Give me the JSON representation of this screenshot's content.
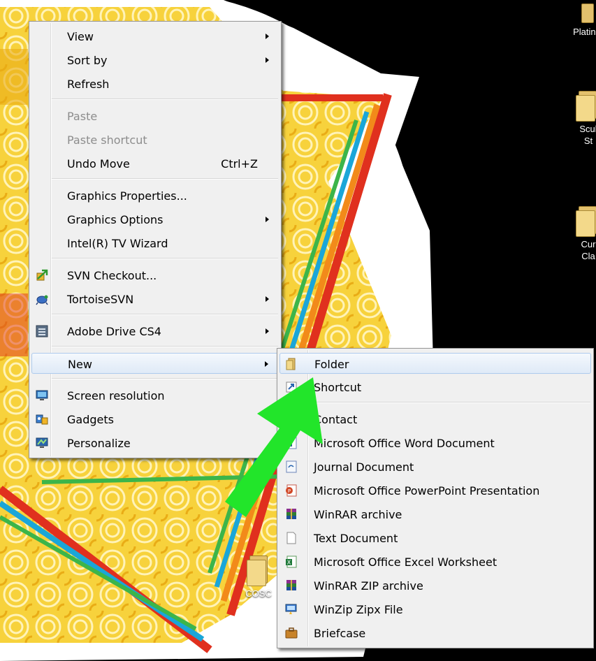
{
  "desktop": {
    "icons": [
      {
        "label": "Platinu"
      },
      {
        "label": "Scul\nSt"
      },
      {
        "label": "Cur\nCla"
      },
      {
        "label": "COSC"
      }
    ]
  },
  "context_menu": {
    "items": [
      {
        "label": "View",
        "has_submenu": true
      },
      {
        "label": "Sort by",
        "has_submenu": true
      },
      {
        "label": "Refresh"
      },
      {
        "label": "Paste",
        "disabled": true
      },
      {
        "label": "Paste shortcut",
        "disabled": true
      },
      {
        "label": "Undo Move",
        "shortcut": "Ctrl+Z"
      },
      {
        "label": "Graphics Properties..."
      },
      {
        "label": "Graphics Options",
        "has_submenu": true
      },
      {
        "label": "Intel(R) TV Wizard"
      },
      {
        "label": "SVN Checkout...",
        "icon": "svn-checkout-icon"
      },
      {
        "label": "TortoiseSVN",
        "icon": "tortoisesvn-icon",
        "has_submenu": true
      },
      {
        "label": "Adobe Drive CS4",
        "icon": "adobe-drive-icon",
        "has_submenu": true
      },
      {
        "label": "New",
        "has_submenu": true,
        "highlighted": true
      },
      {
        "label": "Screen resolution",
        "icon": "monitor-icon"
      },
      {
        "label": "Gadgets",
        "icon": "gadgets-icon"
      },
      {
        "label": "Personalize",
        "icon": "personalize-icon"
      }
    ]
  },
  "new_submenu": {
    "items": [
      {
        "label": "Folder",
        "icon": "folder-icon",
        "highlighted": true
      },
      {
        "label": "Shortcut",
        "icon": "shortcut-icon"
      },
      {
        "label": "Contact",
        "icon": "contact-icon"
      },
      {
        "label": "Microsoft Office Word Document",
        "icon": "word-document-icon"
      },
      {
        "label": "Journal Document",
        "icon": "journal-document-icon"
      },
      {
        "label": "Microsoft Office PowerPoint Presentation",
        "icon": "powerpoint-icon"
      },
      {
        "label": "WinRAR archive",
        "icon": "winrar-icon"
      },
      {
        "label": "Text Document",
        "icon": "text-document-icon"
      },
      {
        "label": "Microsoft Office Excel Worksheet",
        "icon": "excel-icon"
      },
      {
        "label": "WinRAR ZIP archive",
        "icon": "winrar-zip-icon"
      },
      {
        "label": "WinZip Zipx File",
        "icon": "winzip-icon"
      },
      {
        "label": "Briefcase",
        "icon": "briefcase-icon"
      }
    ]
  },
  "colors": {
    "menu_background": "#f0f0f0",
    "highlight": "#dfeaf7",
    "highlight_border": "#aecbed",
    "disabled_text": "#8d8d8d",
    "annotation_arrow": "#22e52a",
    "desktop_background": "#000000"
  }
}
